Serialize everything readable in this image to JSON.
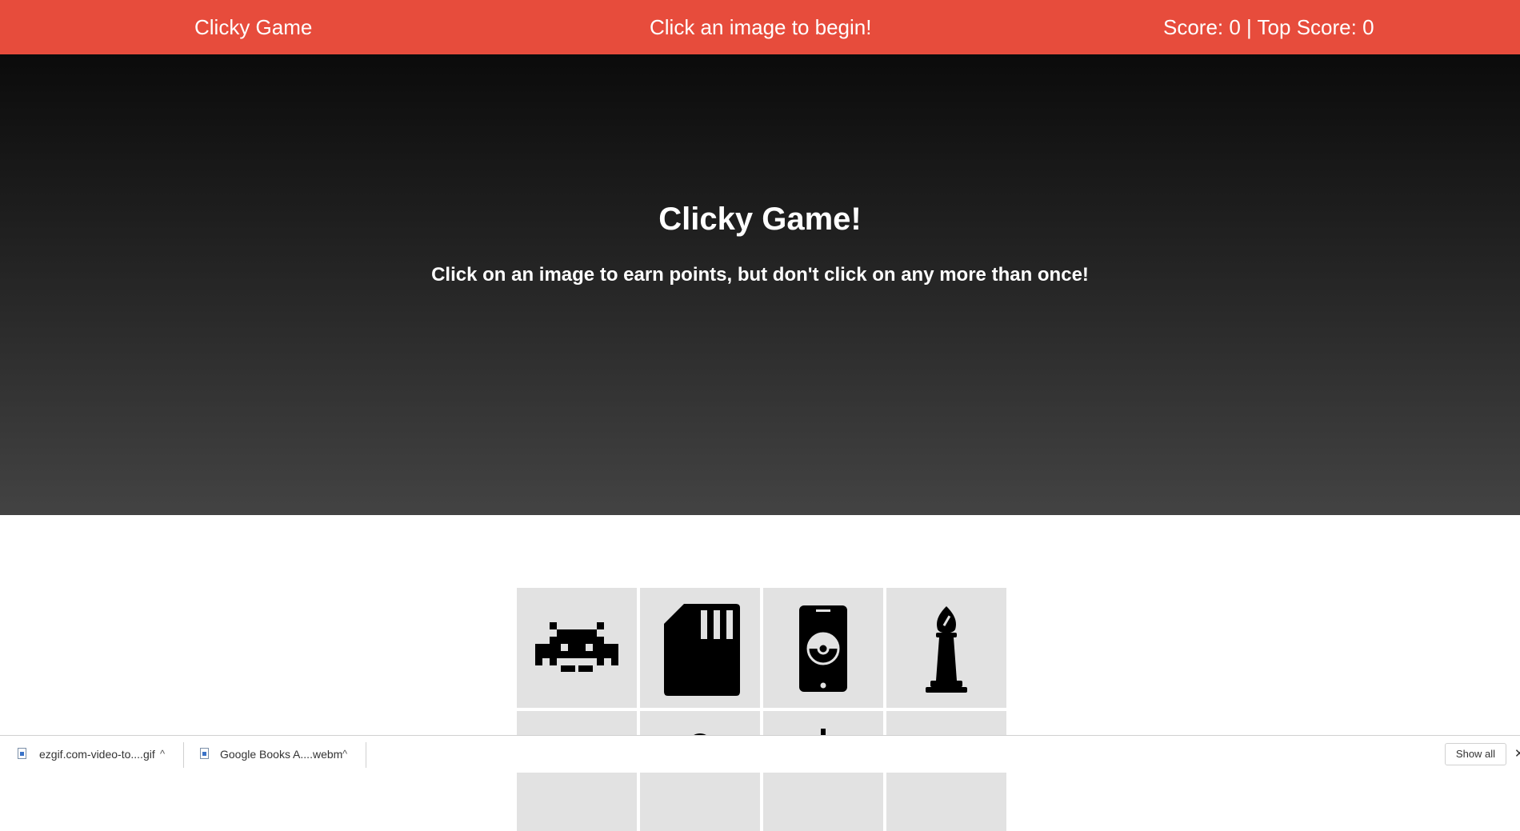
{
  "navbar": {
    "brand": "Clicky Game",
    "message": "Click an image to begin!",
    "score_text": "Score: 0 | Top Score: 0",
    "background_color": "#e74c3c"
  },
  "jumbotron": {
    "title": "Clicky Game!",
    "subtitle": "Click on an image to earn points, but don't click on any more than once!"
  },
  "cards": [
    {
      "icon": "space-invader-icon"
    },
    {
      "icon": "sd-card-icon"
    },
    {
      "icon": "pokeball-phone-icon"
    },
    {
      "icon": "chess-bishop-icon"
    },
    {
      "icon": "partially-visible-icon"
    },
    {
      "icon": "partially-visible-icon"
    },
    {
      "icon": "partially-visible-icon"
    },
    {
      "icon": "blank"
    }
  ],
  "downloads_bar": {
    "items": [
      {
        "name": "ezgif.com-video-to....gif"
      },
      {
        "name": "Google Books A....webm"
      }
    ],
    "show_all_label": "Show all",
    "close_symbol": "✕"
  }
}
